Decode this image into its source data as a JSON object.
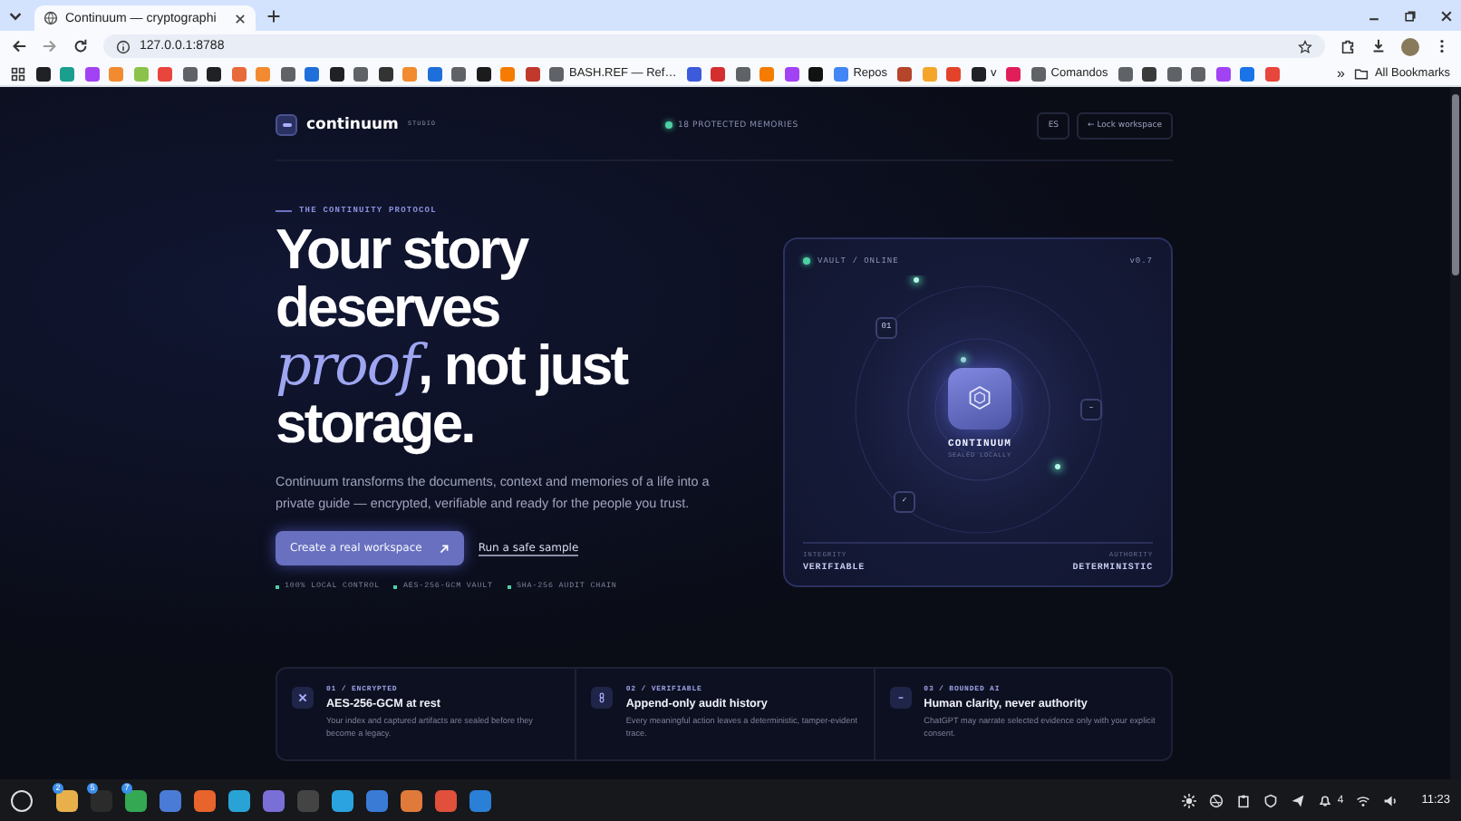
{
  "browser": {
    "tab_title": "Continuum — cryptographi",
    "url": "127.0.0.1:8788",
    "bookmarks": [
      {
        "color": "#202124"
      },
      {
        "color": "#1a9f8f"
      },
      {
        "color": "#a142f4"
      },
      {
        "color": "#f28b30"
      },
      {
        "color": "#8bc34a"
      },
      {
        "color": "#e8453c"
      },
      {
        "color": "#5f6368"
      },
      {
        "color": "#202124"
      },
      {
        "color": "#e86a3a"
      },
      {
        "color": "#f28b30"
      },
      {
        "color": "#5f6368"
      },
      {
        "color": "#1e6fd9"
      },
      {
        "color": "#202124"
      },
      {
        "color": "#5f6368"
      },
      {
        "color": "#333333"
      },
      {
        "color": "#f28b30"
      },
      {
        "color": "#1e6fd9"
      },
      {
        "color": "#5f6368"
      },
      {
        "color": "#1b1b1b"
      },
      {
        "color": "#f57c00"
      },
      {
        "color": "#c0392b"
      },
      {
        "color": "#5f6368",
        "label": "BASH.REF — Ref…"
      },
      {
        "color": "#3b5bdb"
      },
      {
        "color": "#d32f2f"
      },
      {
        "color": "#5f6368"
      },
      {
        "color": "#f57c00"
      },
      {
        "color": "#a142f4"
      },
      {
        "color": "#111111"
      },
      {
        "color": "#4285f4",
        "label": "Repos"
      },
      {
        "color": "#b5452b"
      },
      {
        "color": "#f4a62a"
      },
      {
        "color": "#e2432a"
      },
      {
        "color": "#202124",
        "label": "v"
      },
      {
        "color": "#e01e5a"
      },
      {
        "color": "#5f6368",
        "label": "Comandos"
      },
      {
        "color": "#5f6368"
      },
      {
        "color": "#3a3a3a"
      },
      {
        "color": "#5f6368"
      },
      {
        "color": "#5f6368"
      },
      {
        "color": "#a142f4"
      },
      {
        "color": "#1a73e8"
      },
      {
        "color": "#e8453c"
      }
    ],
    "overflow": "»",
    "all_bookmarks": "All Bookmarks"
  },
  "header": {
    "brand": "continuum",
    "badge": "STUDIO",
    "status": "18 PROTECTED MEMORIES",
    "language": "ES",
    "lock_button": "← Lock workspace"
  },
  "hero": {
    "eyebrow": "THE CONTINUITY PROTOCOL",
    "heading_lines": [
      "Your story",
      "deserves",
      "*proof*, not just",
      "storage."
    ],
    "lead": "Continuum transforms the documents, context and memories of a life into a private guide — encrypted, verifiable and ready for the people you trust.",
    "primary_button": "Create a real workspace",
    "secondary_link": "Run a safe sample",
    "checks": [
      "100% LOCAL CONTROL",
      "AES-256-GCM VAULT",
      "SHA-256 AUDIT CHAIN"
    ]
  },
  "vault": {
    "status": "VAULT / ONLINE",
    "version": "v0.7",
    "nodes": [
      "01",
      "–",
      "✓"
    ],
    "core_title": "CONTINUUM",
    "core_subtitle": "SEALED LOCALLY",
    "stats": [
      {
        "label": "INTEGRITY",
        "value": "VERIFIABLE"
      },
      {
        "label": "AUTHORITY",
        "value": "DETERMINISTIC"
      }
    ]
  },
  "features": [
    {
      "kind": "lock",
      "tag": "01 / ENCRYPTED",
      "title": "AES-256-GCM at rest",
      "text": "Your index and captured artifacts are sealed before they become a legacy."
    },
    {
      "kind": "chain",
      "tag": "02 / VERIFIABLE",
      "title": "Append-only audit history",
      "text": "Every meaningful action leaves a deterministic, tamper-evident trace."
    },
    {
      "kind": "ai",
      "tag": "03 / BOUNDED AI",
      "title": "Human clarity, never authority",
      "text": "ChatGPT may narrate selected evidence only with your explicit consent."
    }
  ],
  "taskbar": {
    "apps": [
      {
        "color": "#e8b04a",
        "badge": "2"
      },
      {
        "color": "#2b2b2b",
        "badge": "5"
      },
      {
        "color": "#34a853",
        "badge": "7"
      },
      {
        "color": "#4a7bd6"
      },
      {
        "color": "#e8642c"
      },
      {
        "color": "#29a3d6"
      },
      {
        "color": "#7a6fd6"
      },
      {
        "color": "#444444"
      },
      {
        "color": "#2aa3e0"
      },
      {
        "color": "#3a7bd6"
      },
      {
        "color": "#e07a3a"
      },
      {
        "color": "#e0503a"
      },
      {
        "color": "#2a7fd6"
      }
    ],
    "tray_count": "4",
    "clock": "11:23"
  }
}
